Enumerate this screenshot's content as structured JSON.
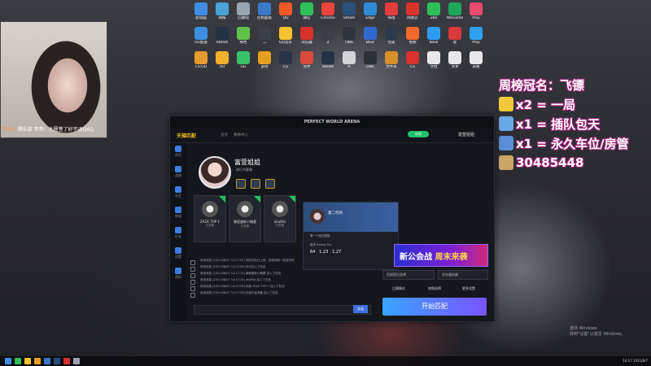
{
  "desktop": {
    "icons": [
      {
        "label": "此电脑",
        "color": "#3e8ee6"
      },
      {
        "label": "网络",
        "color": "#4aa3d8"
      },
      {
        "label": "回收站",
        "color": "#9aa3b0"
      },
      {
        "label": "控制面板",
        "color": "#3c78c8"
      },
      {
        "label": "QQ",
        "color": "#f05a28"
      },
      {
        "label": "微信",
        "color": "#2fbf58"
      },
      {
        "label": "Chrome",
        "color": "#e9453a"
      },
      {
        "label": "Steam",
        "color": "#2a4f7a"
      },
      {
        "label": "Edge",
        "color": "#2e8bd8"
      },
      {
        "label": "咪咕",
        "color": "#e23c3c"
      },
      {
        "label": "网易云",
        "color": "#d8342c"
      },
      {
        "label": "360",
        "color": "#2fbf58"
      },
      {
        "label": "WeGame",
        "color": "#1fa85a"
      },
      {
        "label": "Play",
        "color": "#ea4a72"
      },
      {
        "label": "UU加速",
        "color": "#3c8ee0"
      },
      {
        "label": "Steam",
        "color": "#263346"
      },
      {
        "label": "绿色",
        "color": "#5fc14a"
      },
      {
        "label": "二",
        "color": "#3b3f48"
      },
      {
        "label": "QQ音乐",
        "color": "#f6c230"
      },
      {
        "label": "浏览器",
        "color": "#d8302c"
      },
      {
        "label": "2",
        "color": "#3b3f48"
      },
      {
        "label": "OBS",
        "color": "#30343c"
      },
      {
        "label": "Blue",
        "color": "#2e6ad0"
      },
      {
        "label": "完美",
        "color": "#2e3a4c"
      },
      {
        "label": "视频",
        "color": "#ef6a2b"
      },
      {
        "label": "Kook",
        "color": "#2d9cf0"
      },
      {
        "label": "星",
        "color": "#d93a3a"
      },
      {
        "label": "Play",
        "color": "#2fa0f0"
      },
      {
        "label": "CS:GO",
        "color": "#e59b2b"
      },
      {
        "label": "UU",
        "color": "#f0b02c"
      },
      {
        "label": "GG",
        "color": "#3ac06a"
      },
      {
        "label": "游戏",
        "color": "#e6a020"
      },
      {
        "label": "CS",
        "color": "#2c3448"
      },
      {
        "label": "文件",
        "color": "#d84a3a"
      },
      {
        "label": "Steam",
        "color": "#263346"
      },
      {
        "label": "A",
        "color": "#d2d4d8"
      },
      {
        "label": "OBS",
        "color": "#2b2f36"
      },
      {
        "label": "文件夹",
        "color": "#d88f2a"
      },
      {
        "label": "CS",
        "color": "#d8302c"
      },
      {
        "label": "文档",
        "color": "#e8e8ea"
      },
      {
        "label": "文本",
        "color": "#e8e8ea"
      },
      {
        "label": "表格",
        "color": "#e8e8ea"
      }
    ]
  },
  "webcam": {
    "caption_prefix": "玉V15",
    "caption_text": "俱乐部 李哥：大厘萱了好不退QAQ"
  },
  "overlay": {
    "lines": [
      {
        "text": "周榜冠名：飞镖",
        "icon_color": ""
      },
      {
        "text": "x2 = 一局",
        "icon_color": "#f2c93a"
      },
      {
        "text": "x1 = 插队包天",
        "icon_color": "#6aa8e8"
      },
      {
        "text": "x1 = 永久车位/房管",
        "icon_color": "#5b8fd8"
      },
      {
        "text": "30485448",
        "icon_color": "#c9a86a"
      }
    ]
  },
  "app": {
    "title": "PERFECT WORLD ARENA",
    "logo": "天梯匹配",
    "nav_tabs": [
      "首页",
      "赛事中心"
    ],
    "online_pill": "在线",
    "username": "富萱姐姐",
    "sidebar": [
      "首页",
      "战绩",
      "社区",
      "商城",
      "好友",
      "设置",
      "资料"
    ],
    "profile": {
      "name": "富萱姐姐",
      "link": "进行中赛事"
    },
    "party": [
      {
        "name": "ZACK TOP 1",
        "status": "已准备"
      },
      {
        "name": "喻家盛新小翰基",
        "status": "已准备"
      },
      {
        "name": "akaliKo",
        "status": "已准备"
      }
    ],
    "log_lines": [
      "系统消息 [2021/08/07 14:17:05] 你的好友已上线，快邀请他一起游戏吧",
      "系统消息 [2021/08/07 14:17:05] 你已加入了队伍",
      "系统消息 [2021/08/07 14:17:13] 喻家盛新小翰基 加入了队伍",
      "系统消息 [2021/08/07 14:17:15] akaliKo 加入了队伍",
      "系统消息 [2021/08/07 14:17:26] 玩家 ZACK TOP 1 加入了队伍",
      "系统消息 [2021/08/07 14:17:28] 玩家已经准备 加入了队伍"
    ],
    "send_label": "发送",
    "popup": {
      "name": "富二代的",
      "label1": "第一个段位数据",
      "stats_label": "胜率 Rating Pro",
      "stat_a": "64",
      "stat_b": "1.23",
      "stat_c": "1.27"
    },
    "banner": {
      "part1": "新公会战",
      "part2": "周末来袭"
    },
    "selects": [
      "匹配段位选择",
      "优先服务器"
    ],
    "buttons": [
      "比赛模式",
      "地图选择",
      "更多设置"
    ],
    "start_label": "开始匹配"
  },
  "taskbar": {
    "icons": [
      "#3e8ee6",
      "#2fbf58",
      "#f6c230",
      "#e6a020",
      "#3c78c8",
      "#2a4f7a",
      "#d8302c",
      "#9aa3b0"
    ],
    "clock": "14:17  2021/8/7"
  },
  "watermark": {
    "line1": "激活 Windows",
    "line2": "转到\"设置\"以激活 Windows。"
  }
}
